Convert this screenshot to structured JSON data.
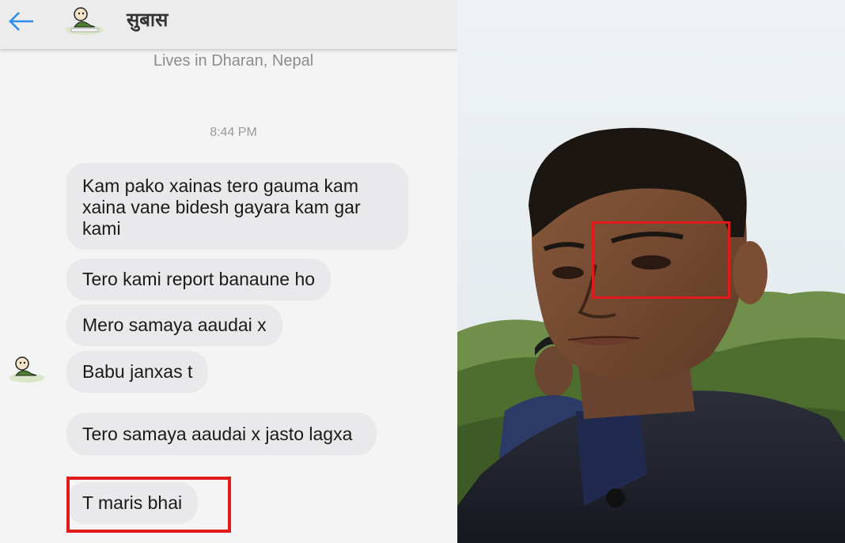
{
  "chat": {
    "contact_name": "सुबास",
    "lives_in": "Lives in Dharan, Nepal",
    "timestamp": "8:44 PM",
    "messages": [
      "Kam pako xainas tero gauma kam xaina vane bidesh gayara kam gar kami",
      "Tero kami report banaune ho",
      "Mero samaya aaudai x",
      "Babu janxas t",
      "Tero samaya aaudai x jasto lagxa",
      "T maris bhai"
    ],
    "highlighted_message": "T maris bhai"
  },
  "colors": {
    "highlight": "#e01b1b",
    "back_arrow": "#2d8cf0",
    "bubble": "#e9e9eb"
  },
  "icons": {
    "back": "arrow-left-icon",
    "avatar": "cartoon-avatar-icon"
  }
}
